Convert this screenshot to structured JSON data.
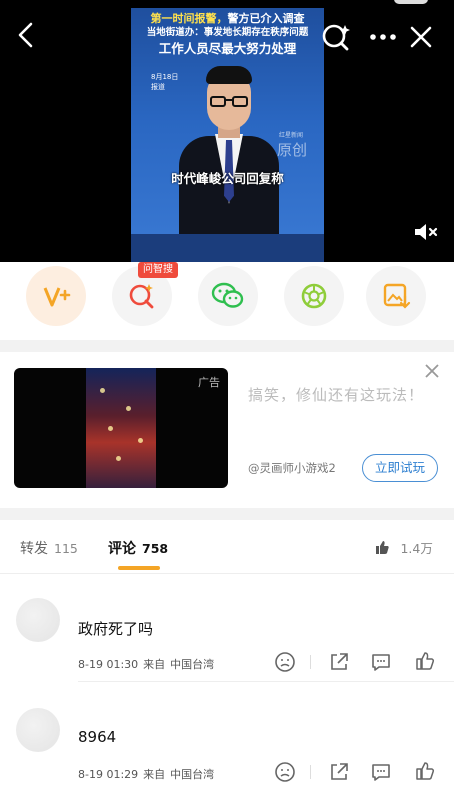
{
  "video": {
    "headline1_a": "第一时间报警，",
    "headline1_b": "警方已介入调查",
    "headline2": "当地街道办：事发地长期存在秩序问题",
    "headline3": "工作人员尽最大努力处理",
    "date": "8月18日",
    "date_sub": "报道",
    "watermark_logo": "红星新闻",
    "watermark": "原创",
    "caption": "时代峰峻公司回复称"
  },
  "share": {
    "ask_badge": "问智搜",
    "items": [
      {
        "icon": "vplus-icon"
      },
      {
        "icon": "ai-search-icon"
      },
      {
        "icon": "wechat-icon"
      },
      {
        "icon": "moments-icon"
      },
      {
        "icon": "save-image-icon"
      }
    ],
    "colors": {
      "orange": "#f4a526",
      "red": "#ef4b3c",
      "green": "#2fbf4f",
      "lightgreen": "#8fcd3a"
    }
  },
  "ad": {
    "tag": "广告",
    "text": "搞笑，修仙还有这玩法！",
    "source": "@灵画师小游戏2",
    "cta": "立即试玩"
  },
  "tabs": {
    "repost_label": "转发",
    "repost_count": "115",
    "comment_label": "评论",
    "comment_count": "758",
    "like_count": "1.4万"
  },
  "comments": [
    {
      "text": "政府死了吗",
      "date": "8-19 01:30",
      "from": "来自",
      "location": "中国台湾"
    },
    {
      "text": "8964",
      "date": "8-19 01:29",
      "from": "来自",
      "location": "中国台湾"
    }
  ]
}
